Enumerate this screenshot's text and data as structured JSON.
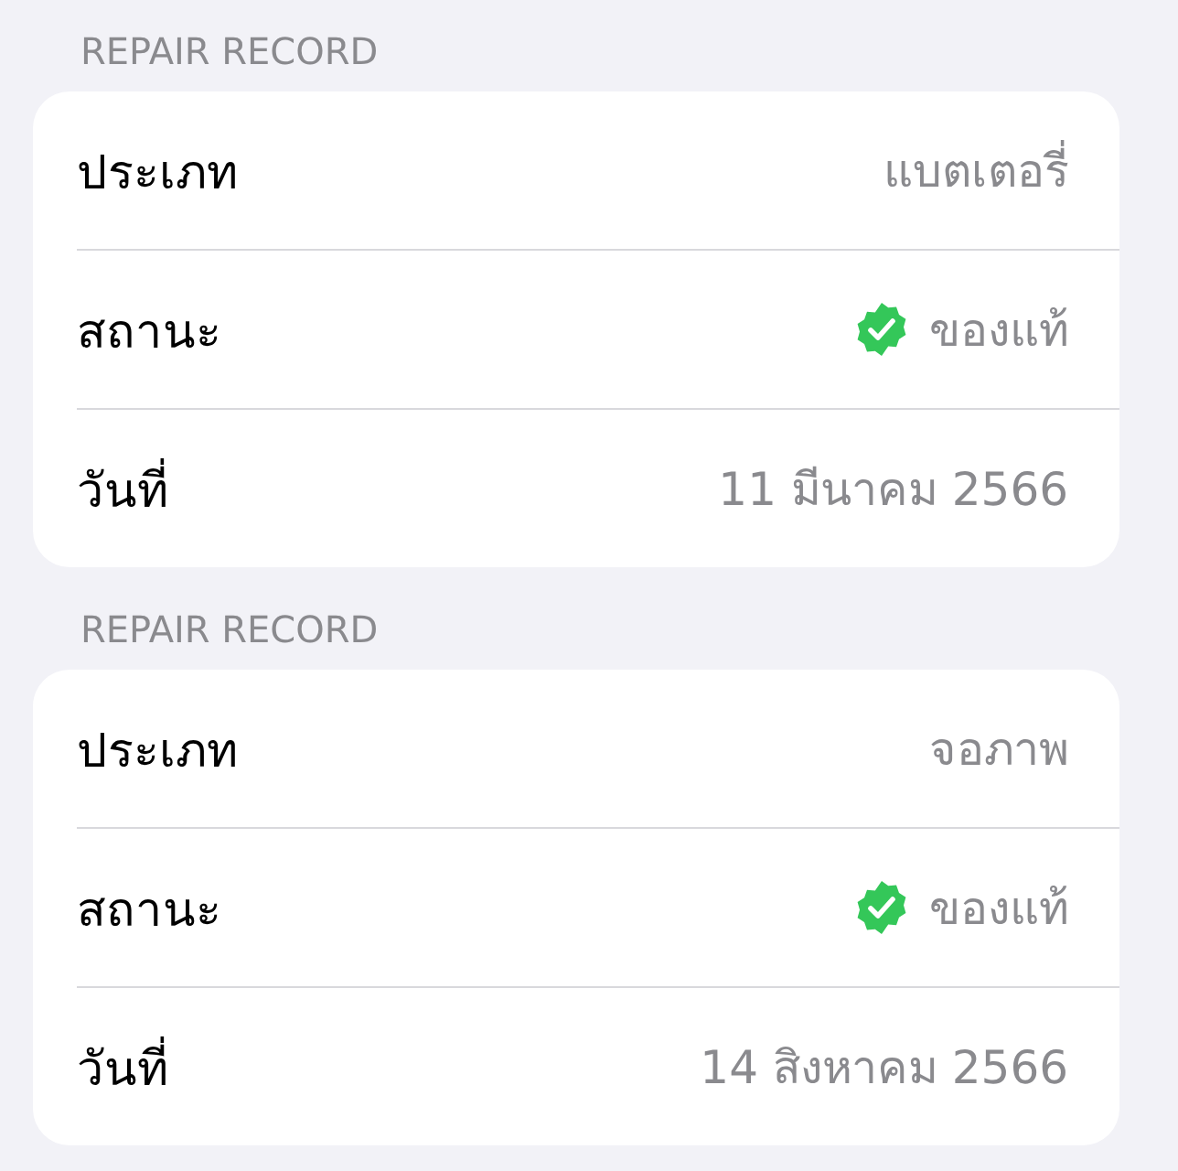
{
  "sections": [
    {
      "header": "REPAIR RECORD",
      "rows": [
        {
          "label": "ประเภท",
          "kind": "text",
          "value": "แบตเตอรี่"
        },
        {
          "label": "สถานะ",
          "kind": "verified",
          "value": "ของแท้"
        },
        {
          "label": "วันที่",
          "kind": "text",
          "value": "11 มีนาคม 2566"
        }
      ]
    },
    {
      "header": "REPAIR RECORD",
      "rows": [
        {
          "label": "ประเภท",
          "kind": "text",
          "value": "จอภาพ"
        },
        {
          "label": "สถานะ",
          "kind": "verified",
          "value": "ของแท้"
        },
        {
          "label": "วันที่",
          "kind": "text",
          "value": "14 สิงหาคม 2566"
        }
      ]
    }
  ]
}
